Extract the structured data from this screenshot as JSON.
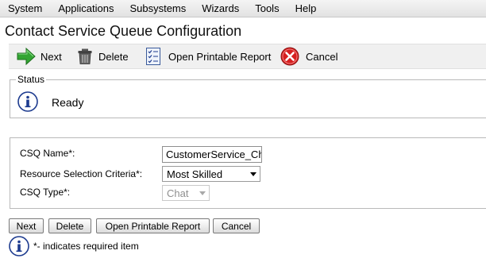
{
  "menu": [
    "System",
    "Applications",
    "Subsystems",
    "Wizards",
    "Tools",
    "Help"
  ],
  "page": {
    "title": "Contact Service Queue Configuration"
  },
  "toolbar": {
    "next_label": "Next",
    "delete_label": "Delete",
    "report_label": "Open Printable Report",
    "cancel_label": "Cancel"
  },
  "status": {
    "legend": "Status",
    "text": "Ready"
  },
  "form": {
    "csq_name_label": "CSQ Name*:",
    "csq_name_value": "CustomerService_Cha",
    "criteria_label": "Resource Selection Criteria*:",
    "criteria_value": "Most Skilled",
    "csq_type_label": "CSQ Type*:",
    "csq_type_value": "Chat"
  },
  "buttons": {
    "next": "Next",
    "delete": "Delete",
    "report": "Open Printable Report",
    "cancel": "Cancel"
  },
  "footnote": "*- indicates required item",
  "colors": {
    "next_arrow": "#2f9e2f",
    "cancel_red": "#d62020",
    "info_blue": "#1d3b8f"
  }
}
